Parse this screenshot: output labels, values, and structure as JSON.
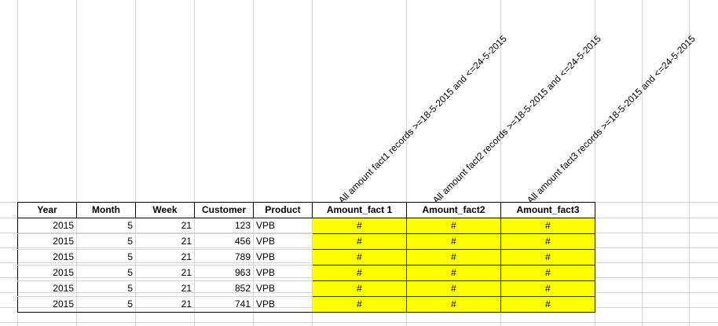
{
  "diagonal_headers": [
    "All amount fact1 records >=18-5-2015 and <=24-5-2015",
    "All amount fact2 records >=18-5-2015 and <=24-5-2015",
    "All amount fact3 records >=18-5-2015 and <=24-5-2015"
  ],
  "table": {
    "headers": [
      "Year",
      "Month",
      "Week",
      "Customer",
      "Product",
      "Amount_fact 1",
      "Amount_fact2",
      "Amount_fact3"
    ],
    "rows": [
      [
        "2015",
        "5",
        "21",
        "123",
        "VPB",
        "#",
        "#",
        "#"
      ],
      [
        "2015",
        "5",
        "21",
        "456",
        "VPB",
        "#",
        "#",
        "#"
      ],
      [
        "2015",
        "5",
        "21",
        "789",
        "VPB",
        "#",
        "#",
        "#"
      ],
      [
        "2015",
        "5",
        "21",
        "963",
        "VPB",
        "#",
        "#",
        "#"
      ],
      [
        "2015",
        "5",
        "21",
        "852",
        "VPB",
        "#",
        "#",
        "#"
      ],
      [
        "2015",
        "5",
        "21",
        "741",
        "VPB",
        "#",
        "#",
        "#"
      ]
    ]
  },
  "colors": {
    "highlight": "#ffff00",
    "gridline": "#d4d4d4",
    "border": "#000000"
  }
}
